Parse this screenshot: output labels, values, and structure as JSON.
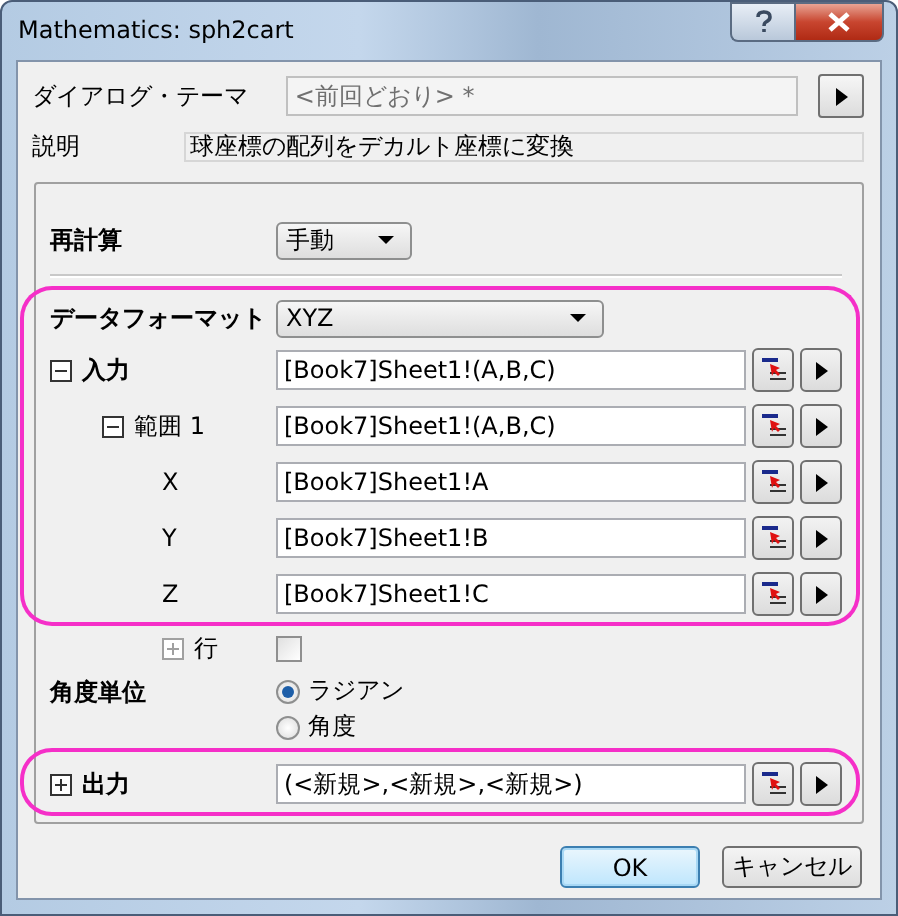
{
  "window": {
    "title": "Mathematics: sph2cart"
  },
  "theme": {
    "label": "ダイアログ・テーマ",
    "value": "<前回どおり> *"
  },
  "description": {
    "label": "説明",
    "value": "球座標の配列をデカルト座標に変換"
  },
  "recalculate": {
    "label": "再計算",
    "value": "手動"
  },
  "parameters": [
    {
      "kind": "dropdown",
      "label": "データフォーマット",
      "value": "XYZ",
      "highlighted": true
    },
    {
      "kind": "range",
      "label": "入力",
      "value": "[Book7]Sheet1!(A,B,C)",
      "expanded": true,
      "highlighted": true,
      "children": [
        {
          "kind": "range",
          "label": "範囲 1",
          "value": "[Book7]Sheet1!(A,B,C)",
          "expanded": true,
          "highlighted": true,
          "children": [
            {
              "kind": "range",
              "label": "X",
              "value": "[Book7]Sheet1!A",
              "highlighted": true
            },
            {
              "kind": "range",
              "label": "Y",
              "value": "[Book7]Sheet1!B",
              "highlighted": true
            },
            {
              "kind": "range",
              "label": "Z",
              "value": "[Book7]Sheet1!C",
              "highlighted": true
            },
            {
              "kind": "checkbox",
              "label": "行",
              "expanded": false,
              "checked": false,
              "highlighted": false
            }
          ]
        }
      ]
    },
    {
      "kind": "radio",
      "label": "角度単位",
      "options": [
        {
          "label": "ラジアン",
          "selected": true
        },
        {
          "label": "角度",
          "selected": false
        }
      ],
      "highlighted": false
    },
    {
      "kind": "range",
      "label": "出力",
      "value": "(<新規>,<新規>,<新規>)",
      "expanded": false,
      "highlighted": true
    }
  ],
  "buttons": [
    {
      "label": "OK",
      "default": true
    },
    {
      "label": "キャンセル",
      "default": false
    }
  ]
}
